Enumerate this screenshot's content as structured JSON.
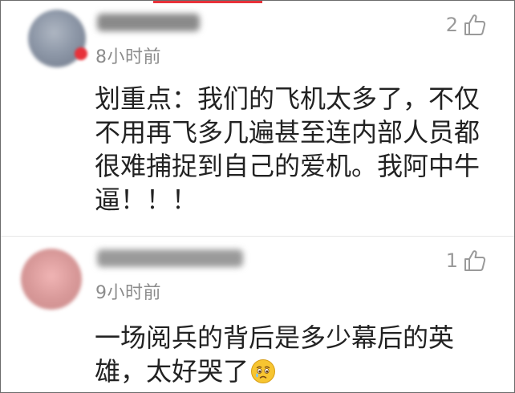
{
  "comments": [
    {
      "time": "8小时前",
      "likes": "2",
      "text": "划重点：我们的飞机太多了，不仅不用再飞多几遍甚至连内部人员都很难捕捉到自己的爱机。我阿中牛逼！！！"
    },
    {
      "time": "9小时前",
      "likes": "1",
      "text": "一场阅兵的背后是多少幕后的英雄，太好哭了",
      "emoji": "crying-face-icon"
    }
  ],
  "colors": {
    "accent": "#e8323a",
    "timestamp": "#8c8c8c",
    "like_count": "#9a9a9a",
    "body_text": "#222222"
  }
}
